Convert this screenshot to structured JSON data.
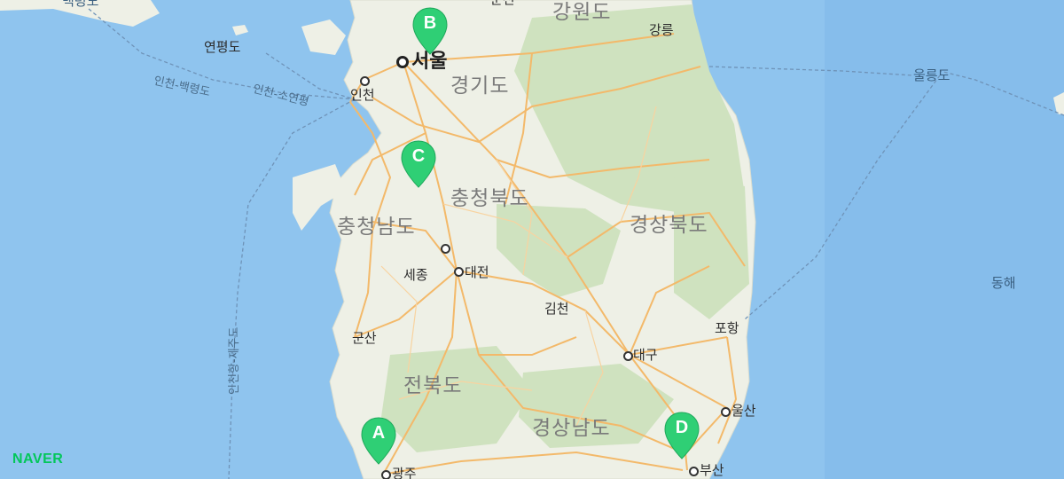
{
  "map": {
    "colors": {
      "sea": "#8fc4ee",
      "land": "#eef0e6",
      "forest": "#cfe2bf",
      "road": "#f3b96a",
      "marker": "#2fcf75"
    },
    "provinces": [
      "강원도",
      "경기도",
      "충청북도",
      "충청남도",
      "경상북도",
      "전북도",
      "경상남도"
    ],
    "capital": "서울",
    "cities": [
      "인천",
      "세종",
      "대전",
      "김천",
      "군산",
      "대구",
      "포항",
      "울산",
      "부산",
      "광주",
      "강릉",
      "춘천",
      "연평도"
    ],
    "seas": [
      "동해",
      "울릉도",
      "백령도"
    ],
    "routes": [
      "인천-백령도",
      "인천-소연평",
      "인천항-제주도"
    ],
    "markers": [
      {
        "label": "A",
        "place": "광주"
      },
      {
        "label": "B",
        "place": "서울"
      },
      {
        "label": "C",
        "place": "충청남도"
      },
      {
        "label": "D",
        "place": "부산"
      }
    ],
    "logo": "NAVER"
  }
}
